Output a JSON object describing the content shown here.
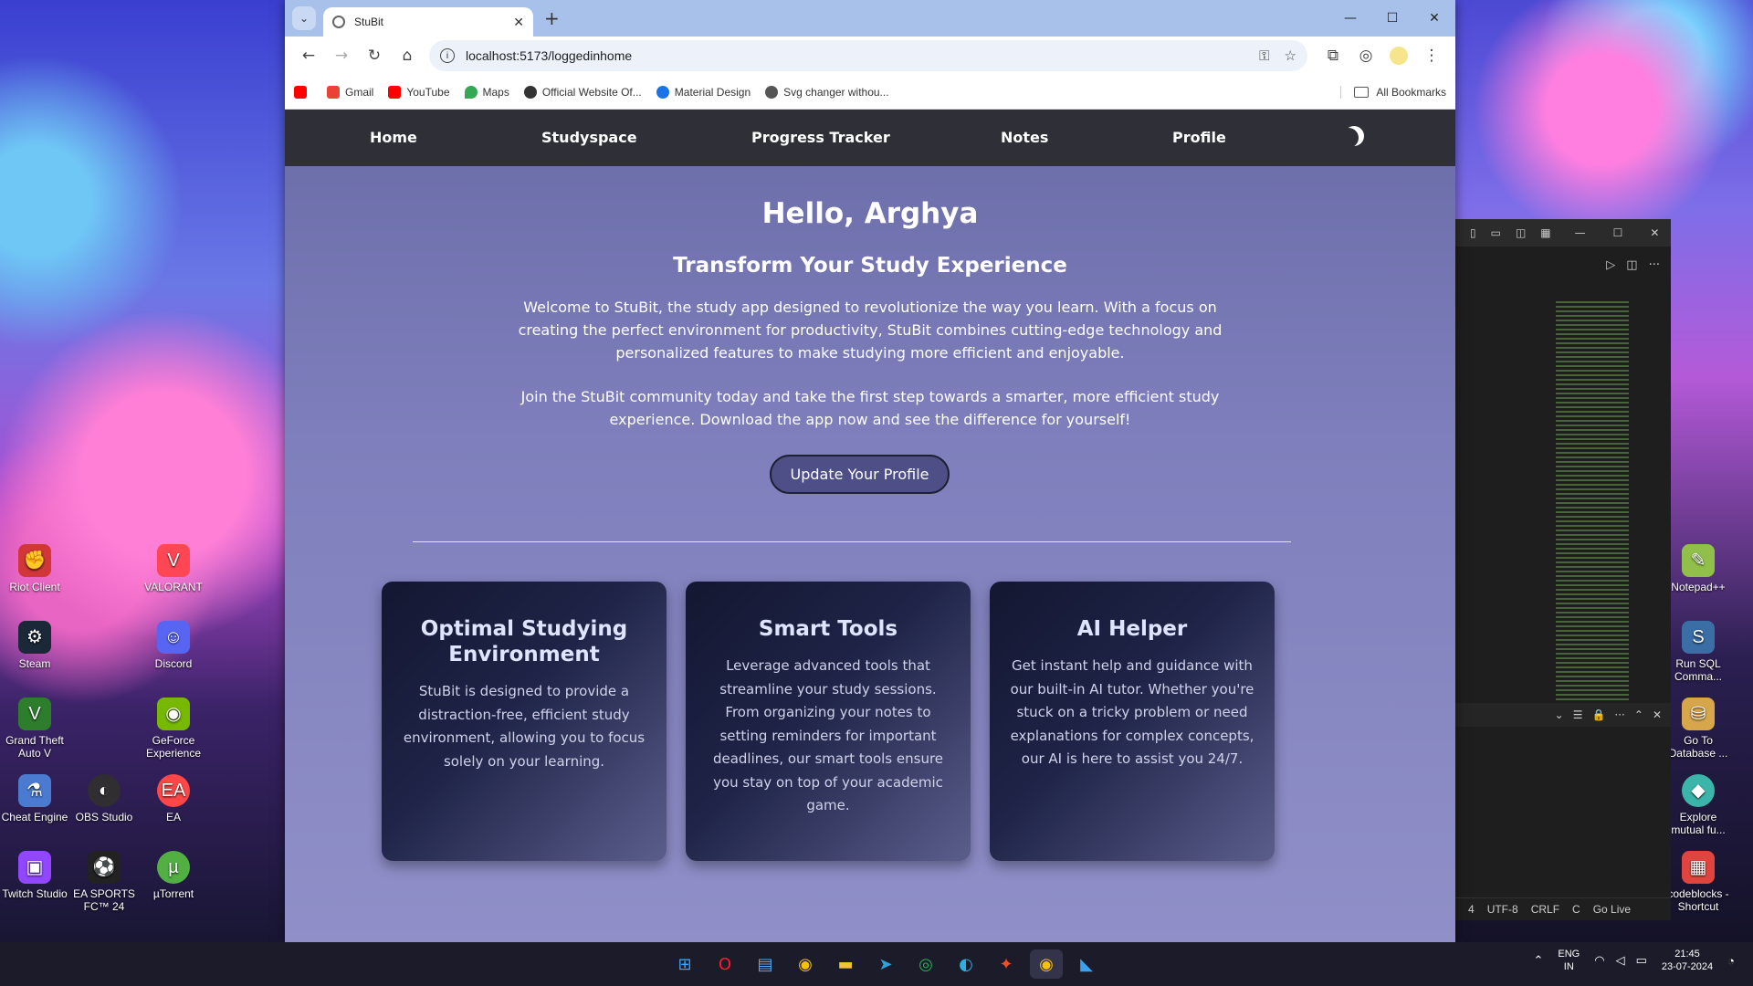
{
  "desktop": {
    "left_icons": [
      {
        "label": "Riot Client",
        "icon": "riot-icon",
        "color": "#d13639"
      },
      {
        "label": "VALORANT",
        "icon": "valorant-icon",
        "color": "#ff4655"
      },
      {
        "label": "Steam",
        "icon": "steam-icon",
        "color": "#1b2838"
      },
      {
        "label": "Discord",
        "icon": "discord-icon",
        "color": "#5865f2"
      },
      {
        "label": "Grand Theft Auto V",
        "icon": "gta-icon",
        "color": "#2d7d2d"
      },
      {
        "label": "GeForce Experience",
        "icon": "geforce-icon",
        "color": "#76b900"
      },
      {
        "label": "Cheat Engine",
        "icon": "cheat-engine-icon",
        "color": "#4a7bd0"
      },
      {
        "label": "OBS Studio",
        "icon": "obs-icon",
        "color": "#302e31"
      },
      {
        "label": "EA",
        "icon": "ea-icon",
        "color": "#ff4747"
      },
      {
        "label": "Twitch Studio",
        "icon": "twitch-icon",
        "color": "#9146ff"
      },
      {
        "label": "EA SPORTS FC™ 24",
        "icon": "ea-sports-fc-icon",
        "color": "#222"
      },
      {
        "label": "µTorrent",
        "icon": "utorrent-icon",
        "color": "#52b043"
      }
    ],
    "right_icons": [
      {
        "label": "Notepad++",
        "icon": "notepadpp-icon",
        "color": "#90c04a"
      },
      {
        "label": "Run SQL Comma...",
        "icon": "sql-icon",
        "color": "#3a6ea5"
      },
      {
        "label": "Go To Database ...",
        "icon": "database-icon",
        "color": "#d8a64a"
      },
      {
        "label": "Explore mutual fu...",
        "icon": "explore-icon",
        "color": "#3bb5a9"
      },
      {
        "label": "codeblocks - Shortcut",
        "icon": "codeblocks-icon",
        "color": "#e0443e"
      }
    ]
  },
  "browser": {
    "tab": {
      "title": "StuBit",
      "close": "✕"
    },
    "new_tab": "+",
    "window_controls": [
      "—",
      "☐",
      "✕"
    ],
    "url": "localhost:5173/loggedinhome",
    "bookmarks": [
      {
        "label": "",
        "color": "#ff0000",
        "icon": "youtube-icon"
      },
      {
        "label": "Gmail",
        "color": "#ea4335",
        "icon": "gmail-icon"
      },
      {
        "label": "YouTube",
        "color": "#ff0000",
        "icon": "youtube-icon"
      },
      {
        "label": "Maps",
        "color": "#34a853",
        "icon": "maps-icon"
      },
      {
        "label": "Official Website Of...",
        "color": "#333",
        "icon": "globe-icon"
      },
      {
        "label": "Material Design",
        "color": "#1a73e8",
        "icon": "material-icon"
      },
      {
        "label": "Svg changer withou...",
        "color": "#555",
        "icon": "gear-icon"
      }
    ],
    "all_bookmarks": "All Bookmarks"
  },
  "site": {
    "nav": [
      "Home",
      "Studyspace",
      "Progress Tracker",
      "Notes",
      "Profile"
    ],
    "greeting": "Hello, Arghya",
    "subtitle": "Transform Your Study Experience",
    "intro": "Welcome to StuBit, the study app designed to revolutionize the way you learn. With a focus on creating the perfect environment for productivity, StuBit combines cutting-edge technology and personalized features to make studying more efficient and enjoyable.",
    "intro2": "Join the StuBit community today and take the first step towards a smarter, more efficient study experience. Download the app now and see the difference for yourself!",
    "update_button": "Update Your Profile",
    "cards": [
      {
        "title": "Optimal Studying Environment",
        "text": "StuBit is designed to provide a distraction-free, efficient study environment, allowing you to focus solely on your learning."
      },
      {
        "title": "Smart Tools",
        "text": "Leverage advanced tools that streamline your study sessions. From organizing your notes to setting reminders for important deadlines, our smart tools ensure you stay on top of your academic game."
      },
      {
        "title": "AI Helper",
        "text": "Get instant help and guidance with our built-in AI tutor. Whether you're stuck on a tricky problem or need explanations for complex concepts, our AI is here to assist you 24/7."
      }
    ]
  },
  "vscode": {
    "status": [
      "4",
      "UTF-8",
      "CRLF",
      "C",
      "Go Live"
    ]
  },
  "taskbar": {
    "language": "ENG",
    "region": "IN",
    "time": "21:45",
    "date": "23-07-2024"
  }
}
